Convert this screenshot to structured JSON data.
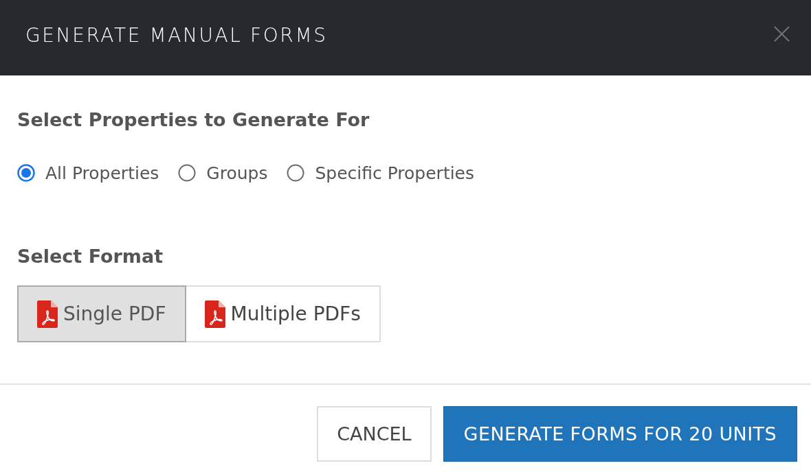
{
  "dialog": {
    "title": "GENERATE MANUAL FORMS"
  },
  "properties_section": {
    "heading": "Select Properties to Generate For",
    "options": [
      {
        "label": "All Properties",
        "selected": true
      },
      {
        "label": "Groups",
        "selected": false
      },
      {
        "label": "Specific Properties",
        "selected": false
      }
    ]
  },
  "format_section": {
    "heading": "Select Format",
    "options": [
      {
        "label": "Single PDF",
        "selected": true
      },
      {
        "label": "Multiple PDFs",
        "selected": false
      }
    ]
  },
  "buttons": [
    {
      "label": "CANCEL",
      "kind": "secondary"
    },
    {
      "label": "GENERATE FORMS FOR 20 UNITS",
      "kind": "primary"
    }
  ]
}
